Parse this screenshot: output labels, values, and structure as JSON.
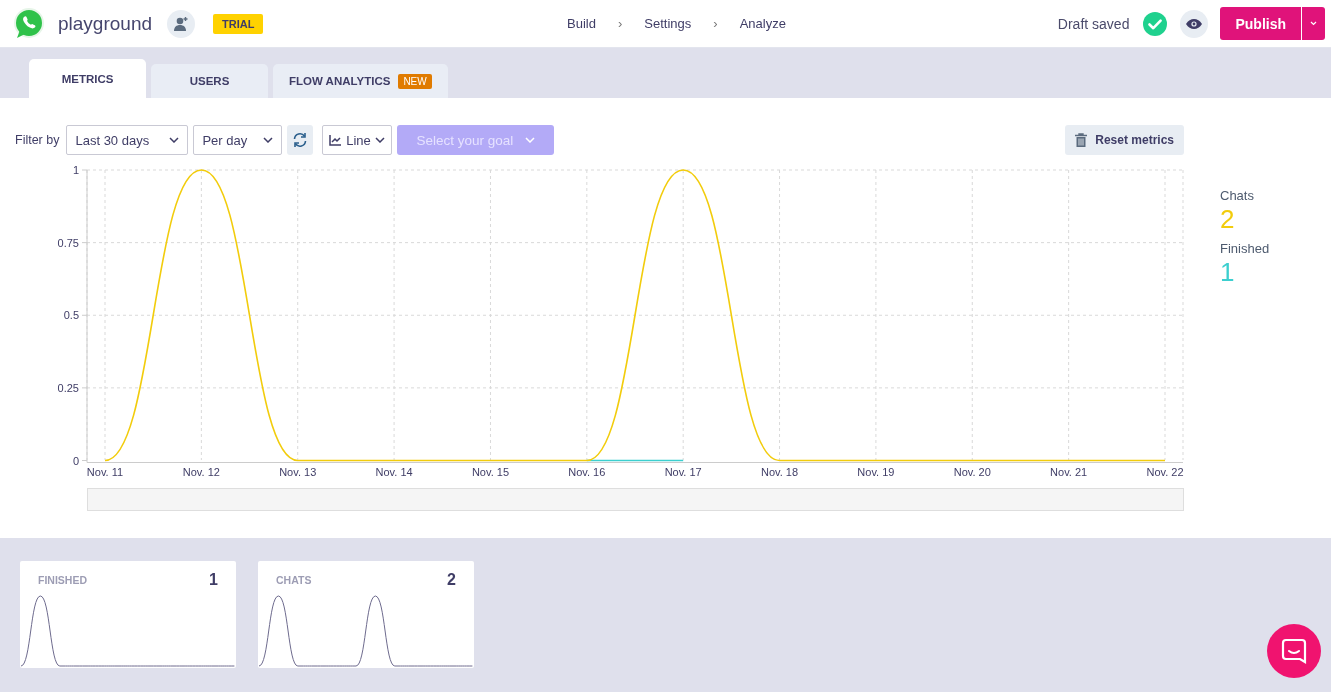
{
  "header": {
    "app_name": "playground",
    "plan_badge": "TRIAL",
    "breadcrumbs": [
      "Build",
      "Settings",
      "Analyze"
    ],
    "separator": "›",
    "status": "Draft saved",
    "publish_button": "Publish"
  },
  "tabs": [
    {
      "label": "METRICS",
      "selected": true
    },
    {
      "label": "USERS",
      "selected": false
    },
    {
      "label": "FLOW ANALYTICS",
      "selected": false,
      "badge": "NEW"
    }
  ],
  "filters": {
    "label": "Filter by",
    "period": "Last 30 days",
    "granularity": "Per day",
    "chart_type": "Line",
    "goal": {
      "placeholder": "Select your goal",
      "disabled": true
    },
    "reset_button": "Reset metrics"
  },
  "chart": {
    "chart_data": {
      "type": "line",
      "categories": [
        "Nov. 11",
        "Nov. 12",
        "Nov. 13",
        "Nov. 14",
        "Nov. 15",
        "Nov. 16",
        "Nov. 17",
        "Nov. 18",
        "Nov. 19",
        "Nov. 20",
        "Nov. 21",
        "Nov. 22"
      ],
      "series": [
        {
          "name": "Chats",
          "color": "#f2cc0c",
          "values": [
            0,
            1,
            0,
            0,
            0,
            0,
            1,
            0,
            0,
            0,
            0,
            0
          ]
        },
        {
          "name": "Finished",
          "color": "#3ccfcf",
          "values": [
            null,
            null,
            null,
            null,
            null,
            0,
            0,
            null,
            null,
            null,
            null,
            null
          ]
        }
      ],
      "grid": true,
      "ylim": [
        0,
        1
      ],
      "yticks": [
        {
          "value": 0,
          "label": "0"
        },
        {
          "value": 0.25,
          "label": "0.25"
        },
        {
          "value": 0.5,
          "label": "0.5"
        },
        {
          "value": 0.75,
          "label": "0.75"
        },
        {
          "value": 1,
          "label": "1"
        }
      ]
    }
  },
  "totals": [
    {
      "value": "2"
    },
    {
      "value": "1"
    }
  ],
  "cards": [
    {
      "title": "FINISHED",
      "value": "1"
    },
    {
      "title": "CHATS",
      "value": "2"
    }
  ]
}
